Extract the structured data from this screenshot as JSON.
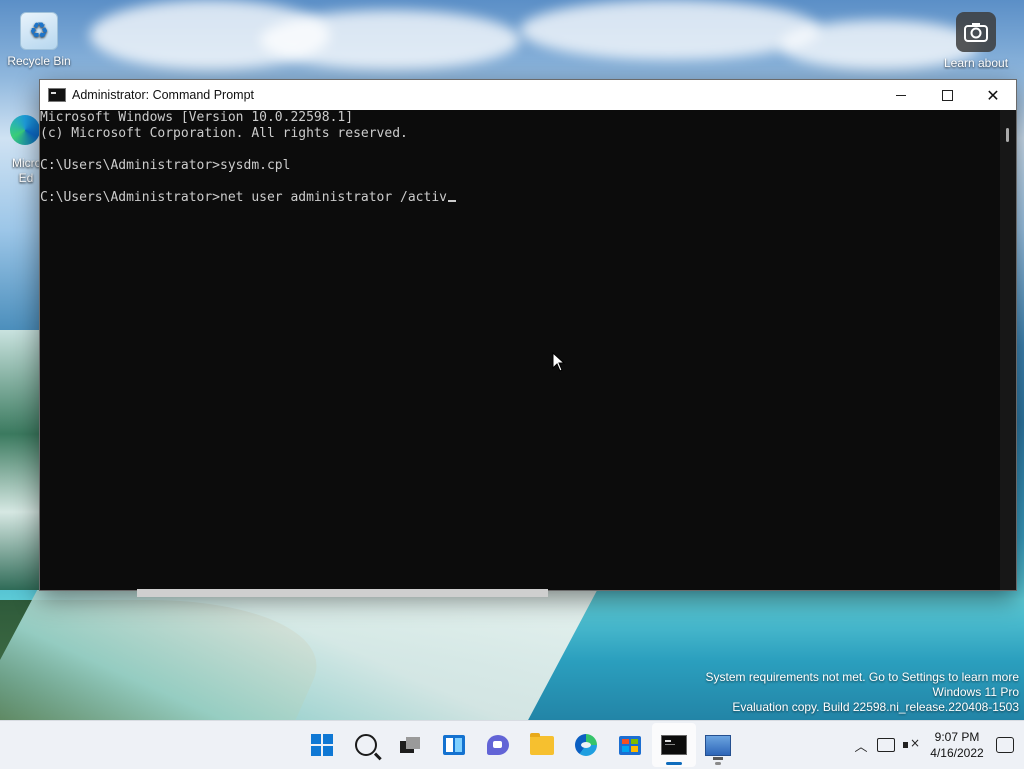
{
  "desktop": {
    "icons": [
      {
        "label": "Recycle Bin"
      },
      {
        "label": "Learn about this picture"
      },
      {
        "label": "Microsoft Edge"
      }
    ],
    "edge_label_line1": "Micro",
    "edge_label_line2": "Ed"
  },
  "window": {
    "title": "Administrator: Command Prompt",
    "minimize": "Minimize",
    "maximize": "Maximize",
    "close": "Close"
  },
  "console": {
    "lines": [
      "Microsoft Windows [Version 10.0.22598.1]",
      "(c) Microsoft Corporation. All rights reserved.",
      "",
      "C:\\Users\\Administrator>sysdm.cpl",
      "",
      "C:\\Users\\Administrator>net user administrator /activ"
    ]
  },
  "watermark": {
    "line1": "System requirements not met. Go to Settings to learn more",
    "line2": "Windows 11 Pro",
    "line3": "Evaluation copy. Build 22598.ni_release.220408-1503"
  },
  "taskbar": {
    "apps": [
      "start-icon",
      "search-icon",
      "task-view-icon",
      "widgets-icon",
      "chat-icon",
      "file-explorer-icon",
      "edge-icon",
      "store-icon",
      "command-prompt-icon",
      "remote-desktop-icon"
    ],
    "accent": "#0f6cbd"
  },
  "tray": {
    "time": "9:07 PM",
    "date": "4/16/2022"
  }
}
